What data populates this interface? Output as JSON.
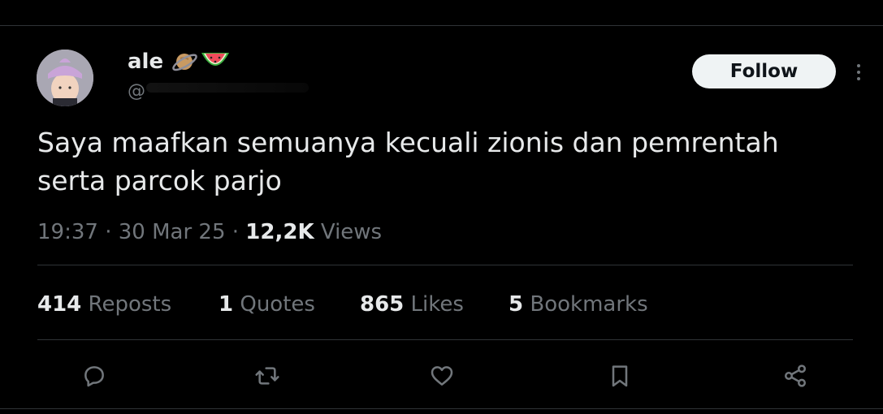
{
  "user": {
    "display_name": "ale",
    "handle": "@",
    "badges": [
      "ringed-planet-icon",
      "watermelon-icon"
    ]
  },
  "follow_button": {
    "label": "Follow"
  },
  "tweet": {
    "text": "Saya maafkan semuanya kecuali zionis dan pemrentah serta parcok parjo",
    "time": "19:37",
    "date": "30 Mar 25",
    "views_count": "12,2K",
    "views_label": "Views"
  },
  "stats": {
    "reposts": {
      "count": "414",
      "label": "Reposts"
    },
    "quotes": {
      "count": "1",
      "label": "Quotes"
    },
    "likes": {
      "count": "865",
      "label": "Likes"
    },
    "bookmarks": {
      "count": "5",
      "label": "Bookmarks"
    }
  },
  "actions": [
    "reply-icon",
    "repost-icon",
    "like-icon",
    "bookmark-icon",
    "share-icon"
  ],
  "colors": {
    "background": "#000000",
    "text": "#e7e9ea",
    "muted": "#71767b",
    "divider": "#2f3336",
    "follow_bg": "#eff3f4"
  }
}
